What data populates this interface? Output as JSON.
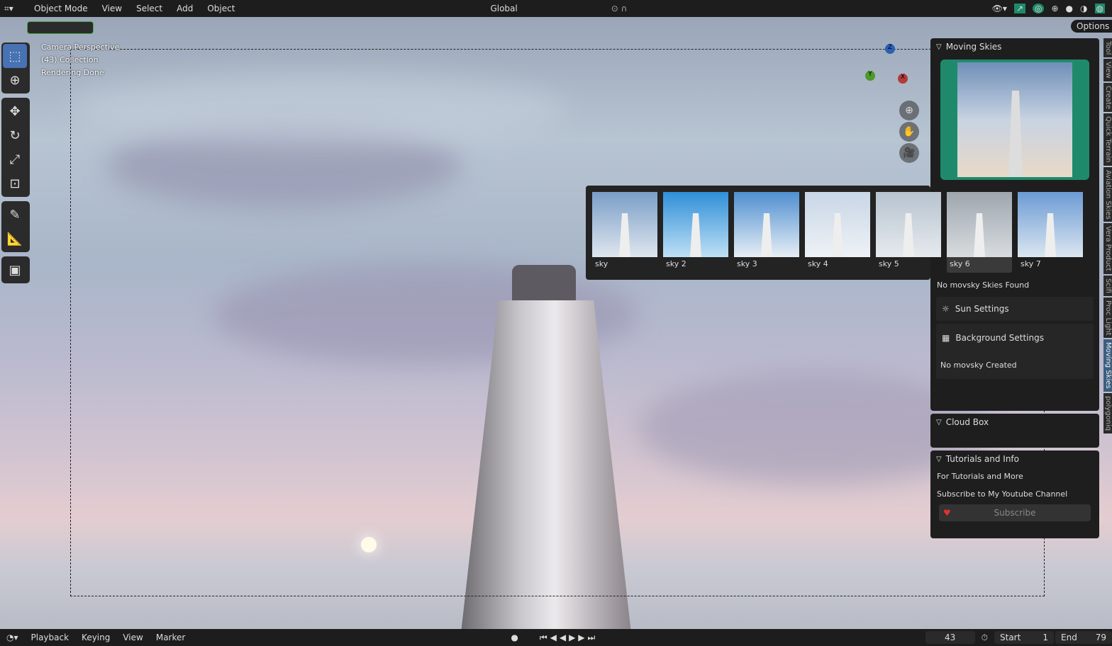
{
  "topbar": {
    "mode": "Object Mode",
    "menus": [
      "View",
      "Select",
      "Add",
      "Object"
    ],
    "orientation": "Global",
    "options": "Options"
  },
  "overlay": {
    "line1": "Camera Perspective",
    "line2": "(43) Collection",
    "line3": "Rendering Done"
  },
  "gizmo": {
    "z": "Z",
    "y": "Y",
    "x": "X"
  },
  "npanel": {
    "moving_skies": "Moving Skies",
    "no_skies": "No movsky Skies Found",
    "sun_settings": "Sun Settings",
    "background_settings": "Background Settings",
    "no_created": "No movsky Created",
    "cloud_box": "Cloud Box",
    "tutorials": "Tutorials and Info",
    "tut_line1": "For Tutorials and More",
    "tut_line2": "Subscribe to My Youtube Channel",
    "subscribe": "Subscribe"
  },
  "tabs": [
    "Tool",
    "View",
    "Create",
    "Quick Terrain",
    "Aviation Skies",
    "Vera Product",
    "Scifi",
    "Proc Light",
    "Moving Skies",
    "polygoniq"
  ],
  "active_tab": "Moving Skies",
  "skies": [
    {
      "label": "sky"
    },
    {
      "label": "sky 2"
    },
    {
      "label": "sky 3"
    },
    {
      "label": "sky 4"
    },
    {
      "label": "sky 5"
    },
    {
      "label": "sky 6"
    },
    {
      "label": "sky 7"
    }
  ],
  "selected_sky": "sky 6",
  "bottombar": {
    "menus": [
      "Playback",
      "Keying",
      "View",
      "Marker"
    ],
    "frame": "43",
    "start_label": "Start",
    "start": "1",
    "end_label": "End",
    "end": "79"
  },
  "colors": {
    "accent": "#4772b3",
    "green": "#1f8a6b",
    "active_tab": "#3b5e7e"
  }
}
